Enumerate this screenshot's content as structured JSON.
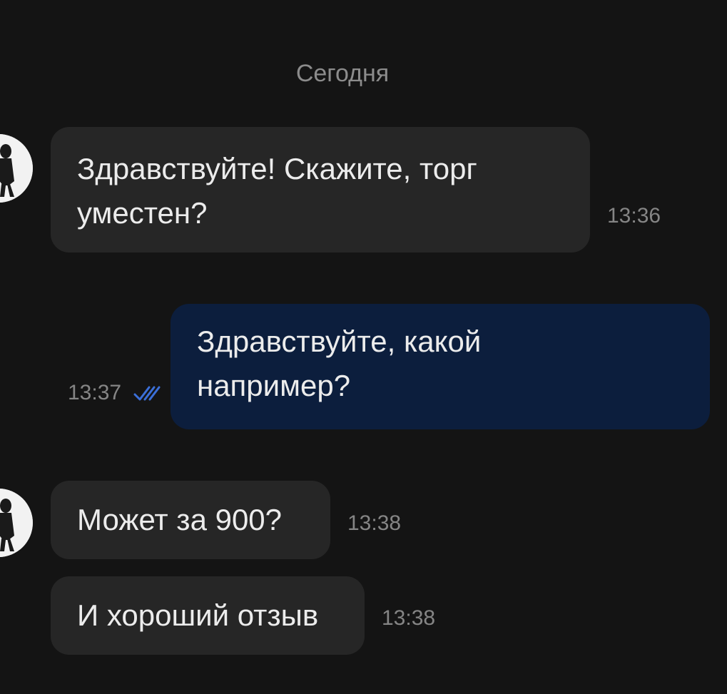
{
  "chat": {
    "date_divider": "Сегодня",
    "messages": [
      {
        "direction": "incoming",
        "text": "Здравствуйте! Скажите, торг\nуместен?",
        "time": "13:36"
      },
      {
        "direction": "outgoing",
        "text": "Здравствуйте, какой\nнапример?",
        "time": "13:37",
        "status": "read"
      },
      {
        "direction": "incoming",
        "text": "Может за 900?",
        "time": "13:38"
      },
      {
        "direction": "incoming",
        "text": "И хороший отзыв",
        "time": "13:38"
      }
    ]
  },
  "colors": {
    "background": "#141414",
    "incoming_bubble": "#262626",
    "outgoing_bubble": "#0c1e3d",
    "timestamp": "#858585",
    "read_check": "#3b6fd8"
  },
  "icons": {
    "read_receipt": "double-check-icon",
    "avatar": "user-avatar"
  }
}
